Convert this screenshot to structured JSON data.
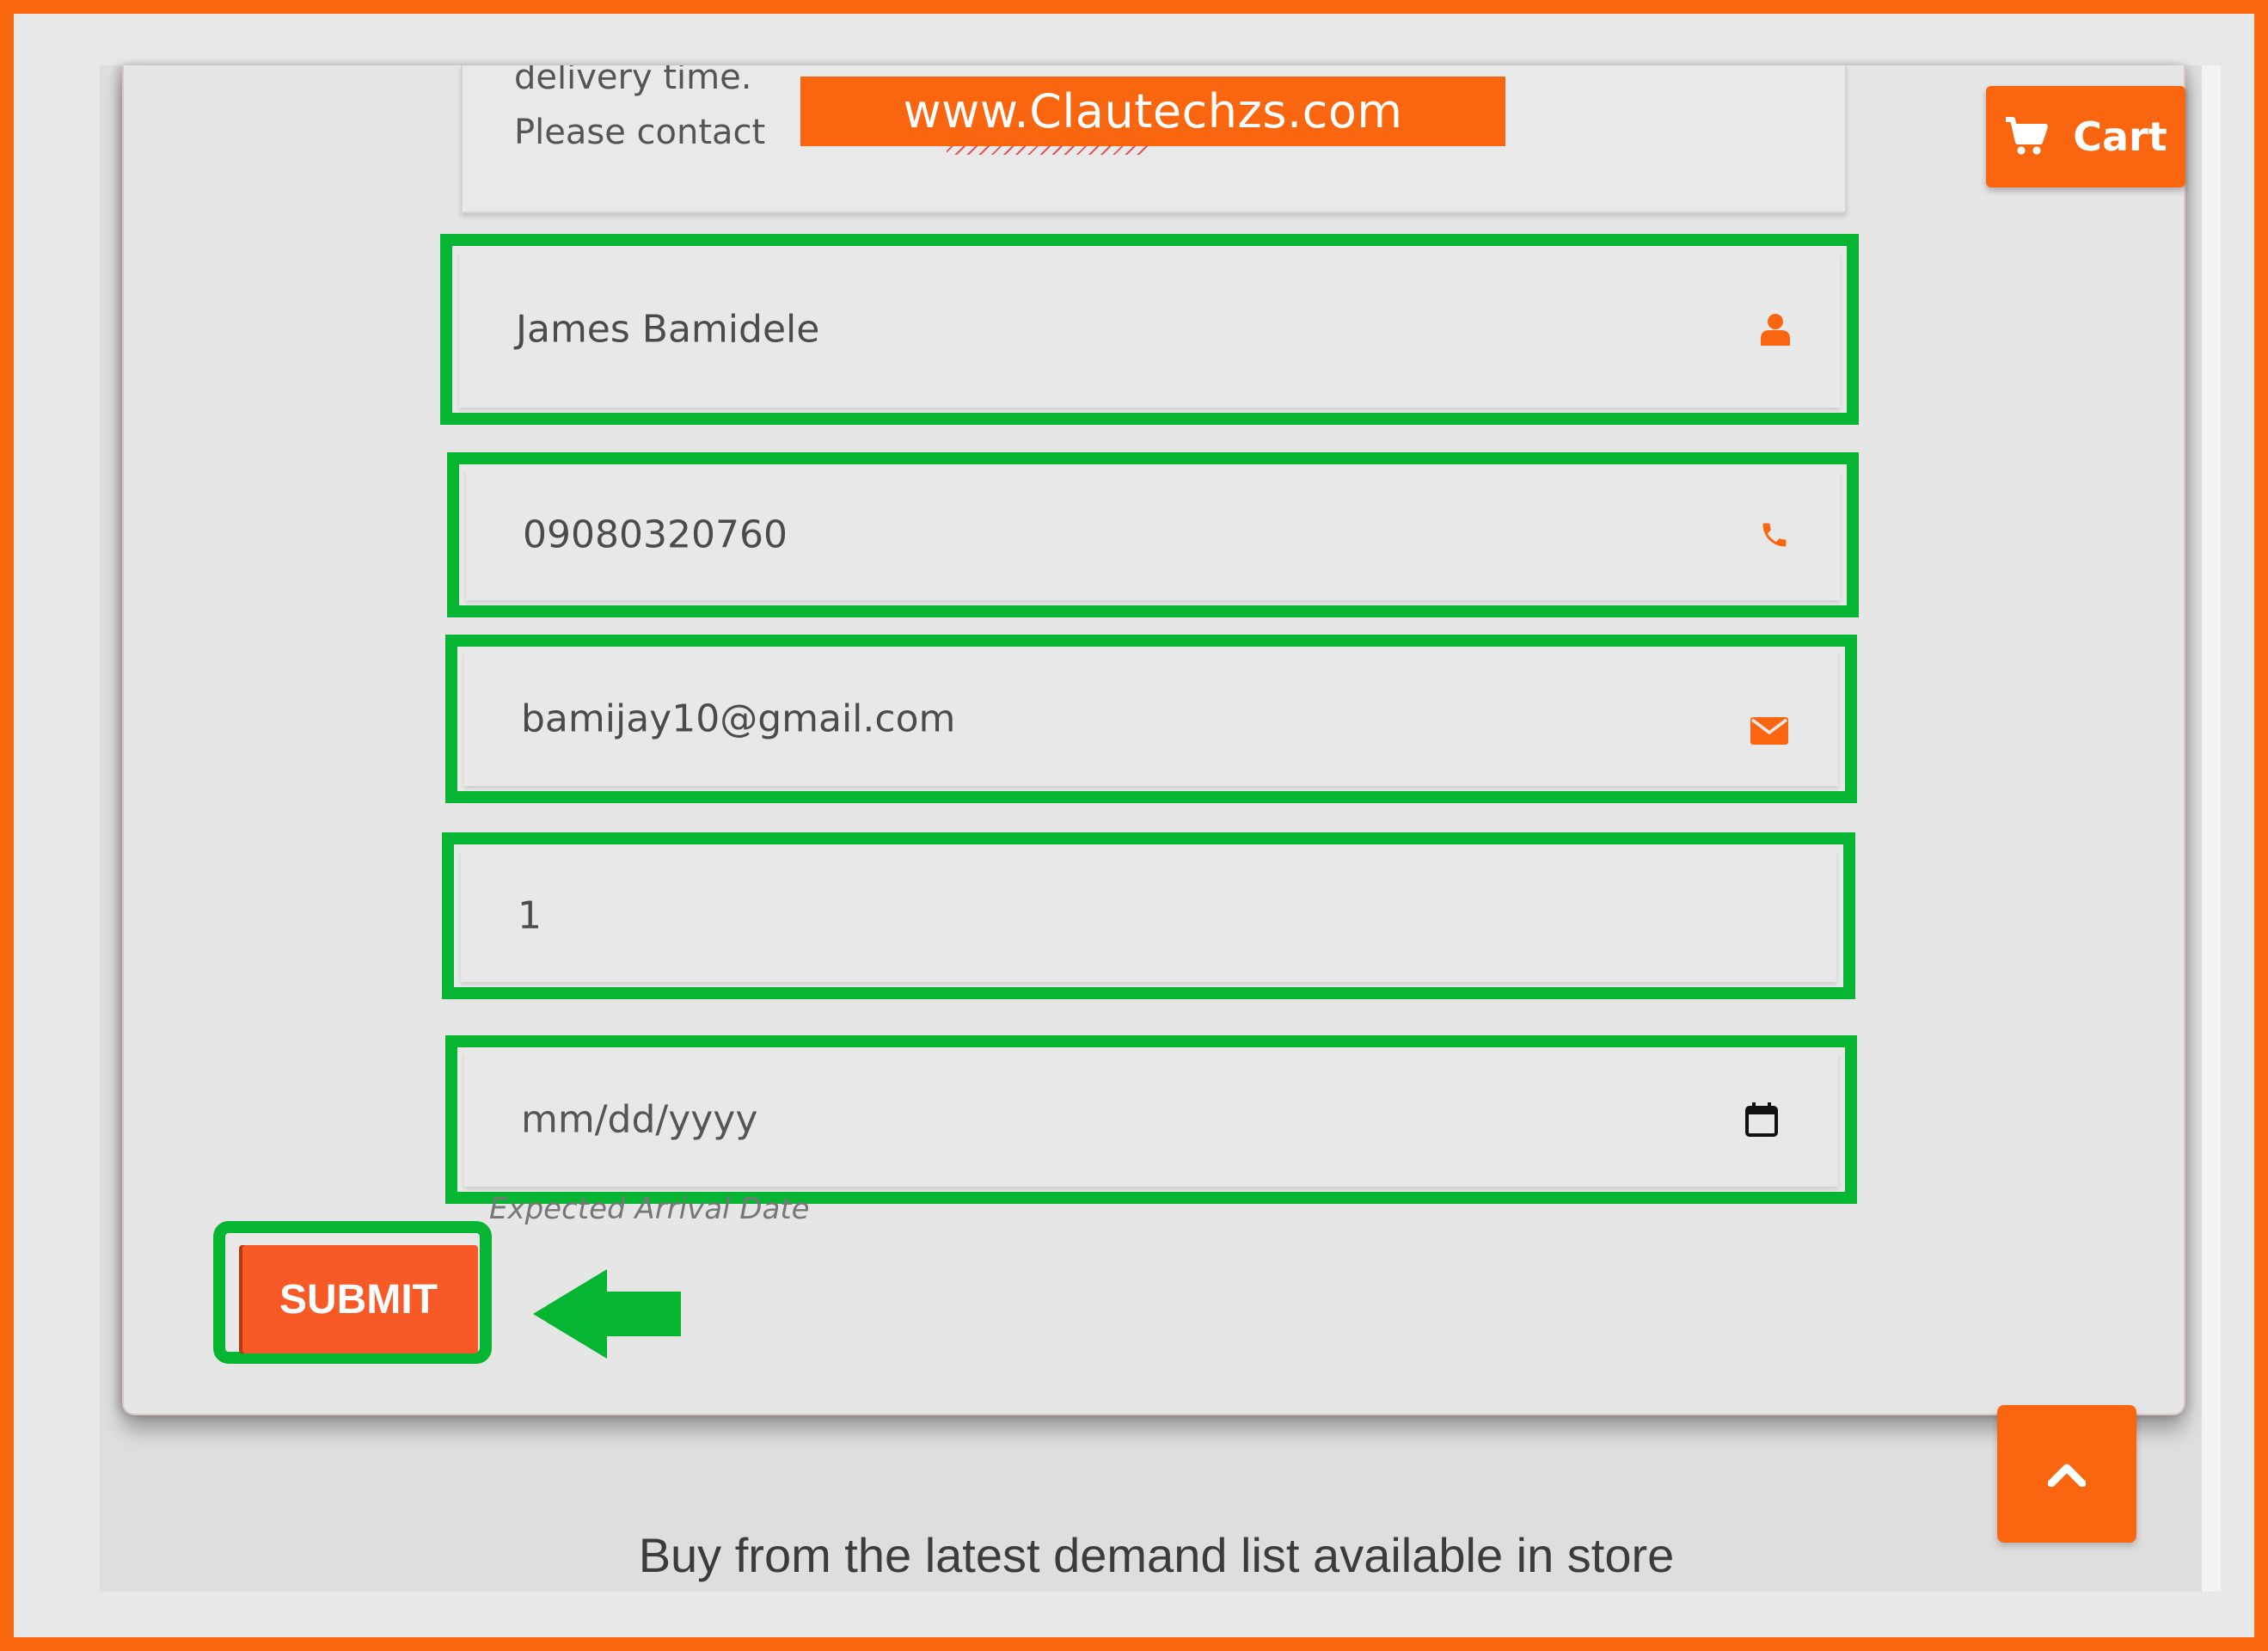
{
  "watermark": "www.Clautechzs.com",
  "header": {
    "cart_label": "Cart"
  },
  "message": {
    "line1": "delivery time.",
    "line2": "Please contact"
  },
  "form": {
    "name_value": "James Bamidele",
    "phone_value": "09080320760",
    "email_value": "bamijay10@gmail.com",
    "quantity_value": "1",
    "date_placeholder": "mm/dd/yyyy",
    "date_helper": "Expected Arrival Date",
    "submit_label": "SUBMIT"
  },
  "footer": {
    "text": "Buy from the latest demand list available in store"
  },
  "icons": {
    "name": "user-icon",
    "phone": "phone-icon",
    "email": "envelope-icon",
    "date": "calendar-icon",
    "cart": "cart-icon",
    "scroll_top": "chevron-up-icon",
    "annotation": "arrow-left-icon"
  },
  "colors": {
    "accent": "#fa660f",
    "highlight": "#06b532",
    "submit": "#f75a26"
  }
}
